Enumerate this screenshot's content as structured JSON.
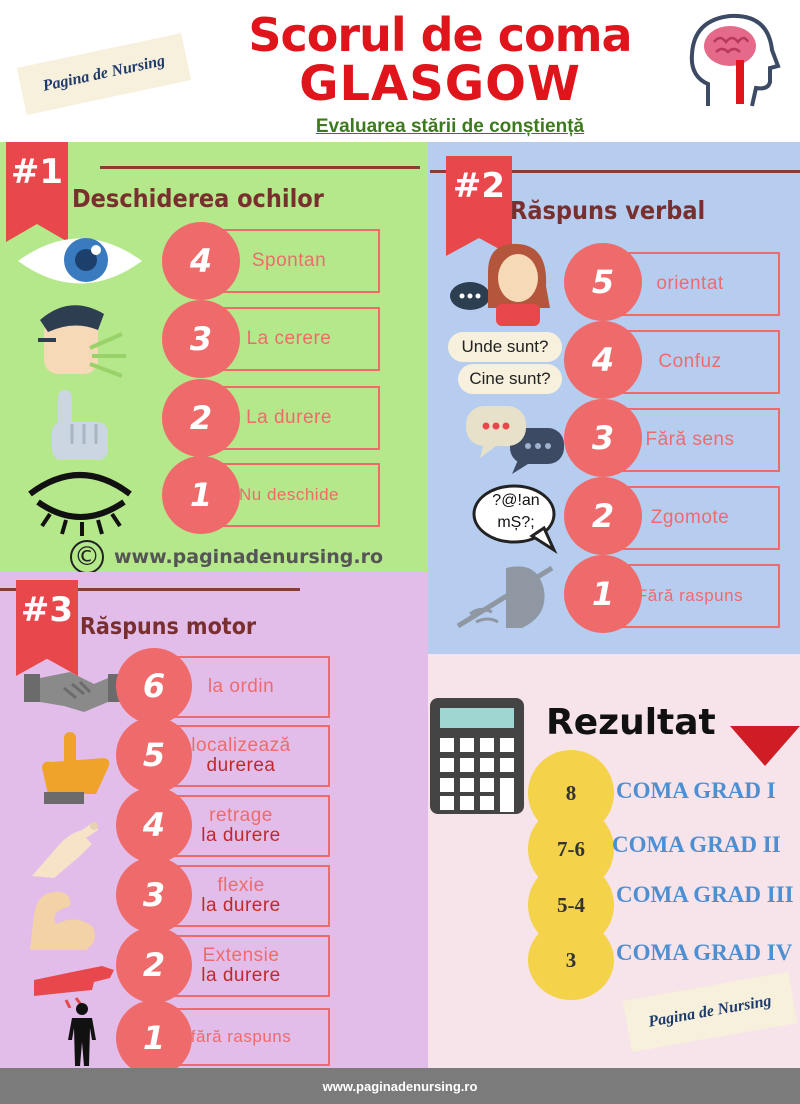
{
  "header": {
    "title_line1": "Scorul de coma",
    "title_line2": "GLASGOW",
    "subtitle": "Evaluarea stării de conștiență",
    "banner_text": "Pagina de Nursing"
  },
  "colors": {
    "accent": "#ef6b6b",
    "title_red": "#e0141b",
    "panel1_bg": "#b5e88a",
    "panel2_bg": "#b6cdf0",
    "panel3_bg": "#e2bdea",
    "panel4_bg": "#f7e3ea",
    "grade_blue": "#4d8fd1"
  },
  "section1": {
    "badge": "#1",
    "title": "Deschiderea ochilor",
    "items": [
      {
        "score": "4",
        "label": "Spontan",
        "icon": "eye-open-icon"
      },
      {
        "score": "3",
        "label": "La cerere",
        "icon": "shouting-person-icon"
      },
      {
        "score": "2",
        "label": "La durere",
        "icon": "pointing-hand-icon"
      },
      {
        "score": "1",
        "label": "Nu deschide",
        "icon": "eye-closed-icon"
      }
    ],
    "watermark_symbol": "©",
    "watermark": "www.paginadenursing.ro"
  },
  "section2": {
    "badge": "#2",
    "title": "Răspuns verbal",
    "items": [
      {
        "score": "5",
        "label": "orientat",
        "icon": "woman-speaking-icon"
      },
      {
        "score": "4",
        "label": "Confuz",
        "icon": "question-bubbles-icon"
      },
      {
        "score": "3",
        "label": "Fără sens",
        "icon": "chat-bubbles-icon"
      },
      {
        "score": "2",
        "label": "Zgomote",
        "icon": "garbled-bubble-icon"
      },
      {
        "score": "1",
        "label": "Fără raspuns",
        "icon": "muted-icon"
      }
    ],
    "bubble_q1": "Unde sunt?",
    "bubble_q2": "Cine sunt?",
    "bubble_garble_1": "?@!an",
    "bubble_garble_2": "mȘ?;"
  },
  "section3": {
    "badge": "#3",
    "title": "Răspuns motor",
    "items": [
      {
        "score": "6",
        "label1": "la ordin",
        "label2": "",
        "icon": "handshake-icon"
      },
      {
        "score": "5",
        "label1": "localizează",
        "label2": "durerea",
        "icon": "pointing-up-hand-icon"
      },
      {
        "score": "4",
        "label1": "retrage",
        "label2": "la durere",
        "icon": "pinch-hand-icon"
      },
      {
        "score": "3",
        "label1": "flexie",
        "label2": "la durere",
        "icon": "flexed-arm-icon"
      },
      {
        "score": "2",
        "label1": "Extensie",
        "label2": "la durere",
        "icon": "extended-arm-icon"
      },
      {
        "score": "1",
        "label1": "fără raspuns",
        "label2": "",
        "icon": "body-silhouette-icon"
      }
    ]
  },
  "result": {
    "title": "Rezultat",
    "grades": [
      {
        "score": "8",
        "label": "COMA GRAD I"
      },
      {
        "score": "7-6",
        "label": "COMA GRAD II"
      },
      {
        "score": "5-4",
        "label": "COMA GRAD III"
      },
      {
        "score": "3",
        "label": "COMA GRAD IV"
      }
    ],
    "banner_text": "Pagina de Nursing"
  },
  "footer": {
    "url": "www.paginadenursing.ro"
  }
}
